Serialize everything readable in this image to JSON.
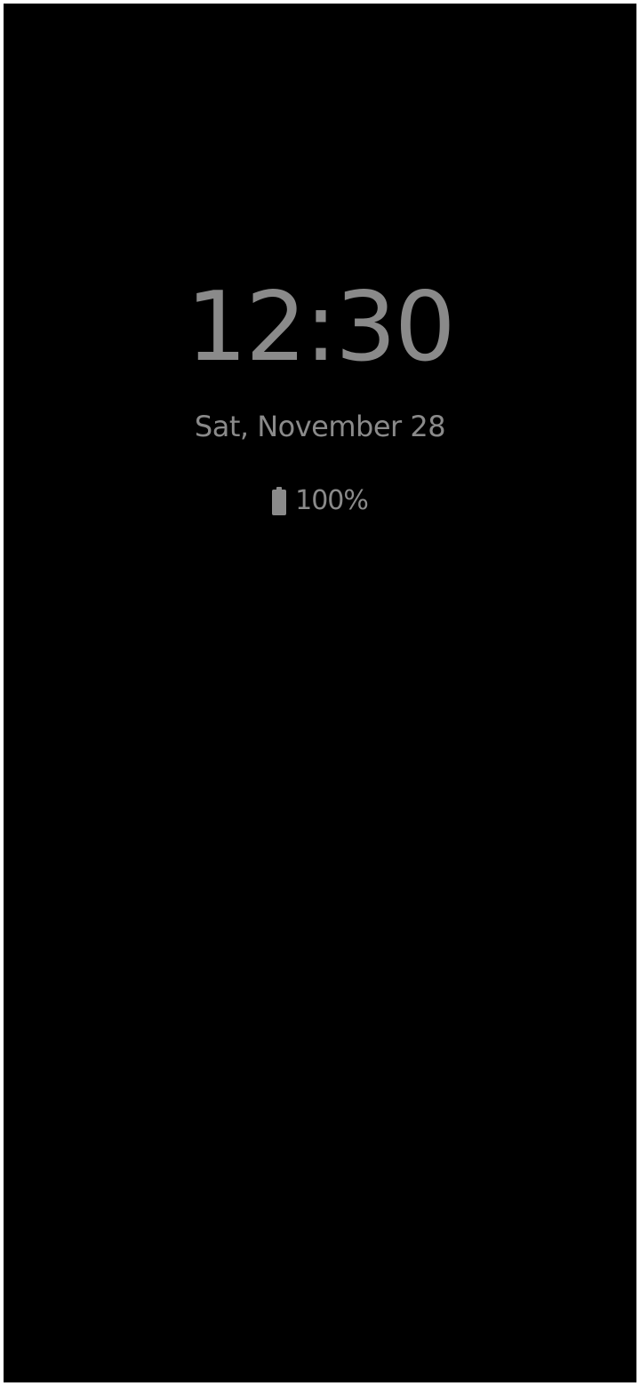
{
  "screen": {
    "background_color": "#000000",
    "text_color": "#8a8a8a"
  },
  "clock": {
    "time": "12:30"
  },
  "date": {
    "text": "Sat, November 28"
  },
  "battery": {
    "icon": "battery-full-icon",
    "level_percent": 100,
    "text": "100%"
  }
}
